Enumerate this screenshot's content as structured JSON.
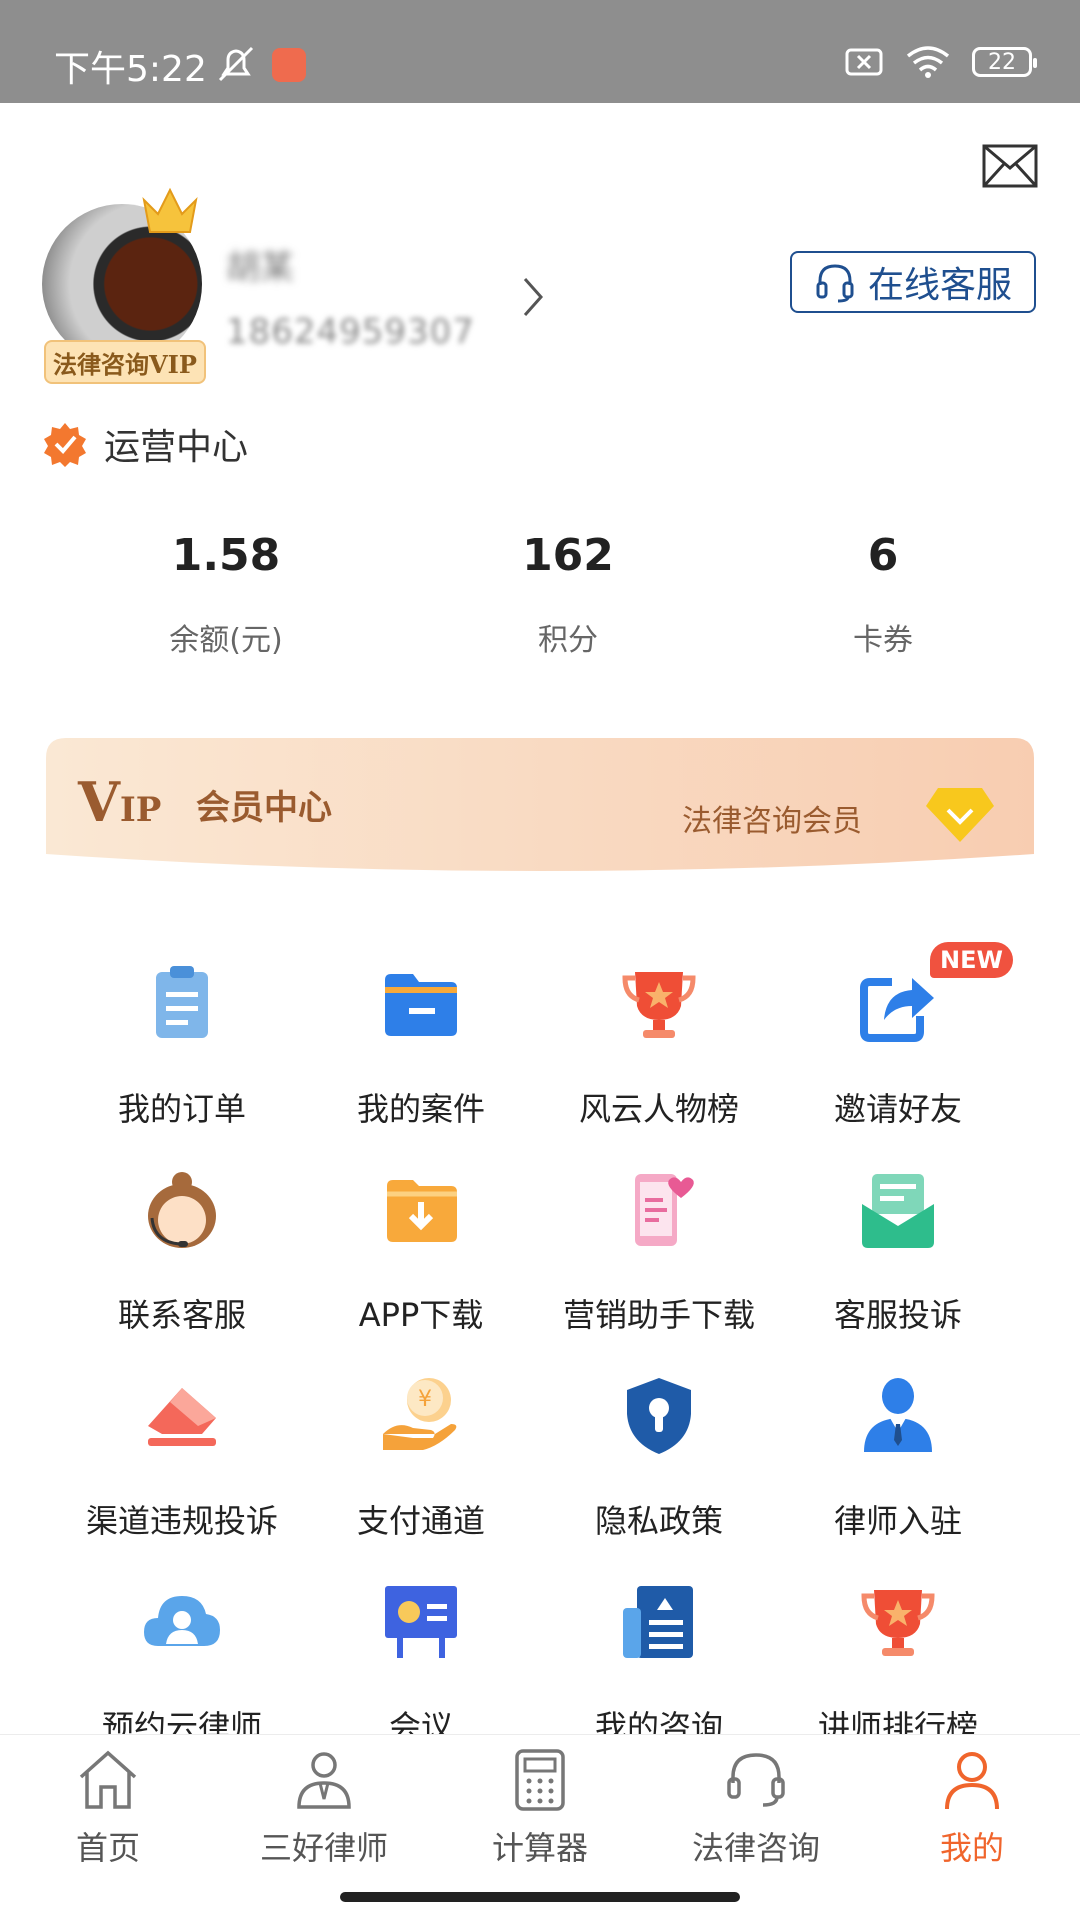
{
  "status_bar": {
    "time": "下午5:22",
    "battery": "22"
  },
  "profile": {
    "vip_badge": "法律咨询VIP",
    "name": "胡某",
    "phone": "18624959307",
    "customer_service_label": "在线客服",
    "org_label": "运营中心"
  },
  "stats": [
    {
      "value": "1.58",
      "label": "余额(元)"
    },
    {
      "value": "162",
      "label": "积分"
    },
    {
      "value": "6",
      "label": "卡券"
    }
  ],
  "vip_banner": {
    "logo_v": "V",
    "logo_ip": "IP",
    "title": "会员中心",
    "subtitle": "法律咨询会员"
  },
  "grid": [
    {
      "label": "我的订单",
      "icon": "clipboard-icon"
    },
    {
      "label": "我的案件",
      "icon": "folder-icon"
    },
    {
      "label": "风云人物榜",
      "icon": "trophy-icon"
    },
    {
      "label": "邀请好友",
      "icon": "share-icon",
      "badge": "NEW"
    },
    {
      "label": "联系客服",
      "icon": "support-agent-icon"
    },
    {
      "label": "APP下载",
      "icon": "download-folder-icon"
    },
    {
      "label": "营销助手下载",
      "icon": "phone-heart-icon"
    },
    {
      "label": "客服投诉",
      "icon": "mail-tray-icon"
    },
    {
      "label": "渠道违规投诉",
      "icon": "eraser-icon"
    },
    {
      "label": "支付通道",
      "icon": "coin-hand-icon"
    },
    {
      "label": "隐私政策",
      "icon": "shield-lock-icon"
    },
    {
      "label": "律师入驻",
      "icon": "lawyer-icon"
    },
    {
      "label": "预约云律师",
      "icon": "cloud-lawyer-icon"
    },
    {
      "label": "会议",
      "icon": "presentation-board-icon"
    },
    {
      "label": "我的咨询",
      "icon": "newspaper-icon"
    },
    {
      "label": "讲师排行榜",
      "icon": "medal-icon"
    }
  ],
  "bottom_nav": [
    {
      "label": "首页",
      "icon": "home-icon"
    },
    {
      "label": "三好律师",
      "icon": "person-icon"
    },
    {
      "label": "计算器",
      "icon": "calculator-icon"
    },
    {
      "label": "法律咨询",
      "icon": "headset-icon"
    },
    {
      "label": "我的",
      "icon": "user-icon",
      "active": true
    }
  ],
  "colors": {
    "accent": "#f0652c",
    "brand_blue": "#1f4f8f",
    "vip_text": "#9a5b2f"
  }
}
